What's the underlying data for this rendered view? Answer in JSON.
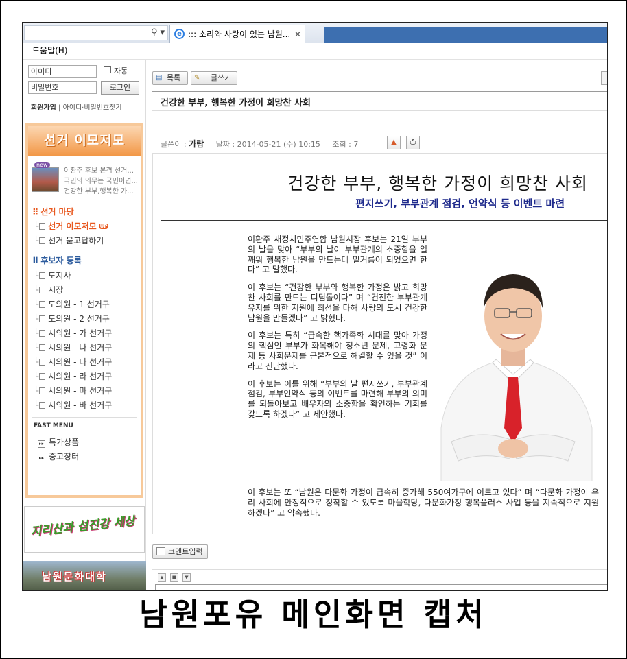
{
  "browser": {
    "tab_title": "::: 소리와 사랑이 있는 남원...",
    "menu": "도움말(H)"
  },
  "login": {
    "id_placeholder": "아이디",
    "pw_placeholder": "비밀번호",
    "auto_label": "자동",
    "login_button": "로그인",
    "join": "회원가입",
    "separator": "|",
    "find": "아이디·비밀번호찾기"
  },
  "sidebar": {
    "banner": "선거 이모저모",
    "new_badge": "new",
    "news": [
      "이환주 후보 본격 선거...",
      "국민의 의무는 국민이면...",
      "건강한 부부,행복한 가..."
    ],
    "section1": "선거 마당",
    "section1_items": [
      "선거 이모저모",
      "선거 묻고답하기"
    ],
    "up_badge": "UP",
    "section2": "후보자 등록",
    "section2_items": [
      "도지사",
      "시장",
      "도의원 - 1 선거구",
      "도의원 - 2 선거구",
      "시의원 - 가 선거구",
      "시의원 - 나 선거구",
      "시의원 - 다 선거구",
      "시의원 - 라 선거구",
      "시의원 - 마 선거구",
      "시의원 - 바 선거구"
    ],
    "fast_menu": "FAST MENU",
    "fast_items": [
      "특가상품",
      "중고장터"
    ],
    "banner1": "지리산과 섬진강 세상",
    "banner2": "남원문화대학"
  },
  "toolbar": {
    "list": "목록",
    "write": "글쓰기"
  },
  "post": {
    "title": "건강한 부부, 행복한 가정이 희망찬 사회",
    "author_label": "글쓴이 :",
    "author": "가람",
    "date_label": "날짜 : 2014-05-21 (수) 10:15",
    "views_label": "조회 : 7",
    "headline": "건강한 부부, 행복한 가정이 희망찬 사회",
    "subhead": "편지쓰기, 부부관계 점검, 언약식 등 이벤트 마련",
    "paragraphs": [
      "이환주 새정치민주연합 남원시장 후보는 21일 부부의 날을 맞아 “부부의 날이 부부관계의 소중함을 일깨워 행복한 남원을 만드는데 밑거름이 되었으면 한다” 고 말했다.",
      "이 후보는 “건강한 부부와 행복한 가정은 밝고 희망찬 사회를 만드는 디딤돌이다” 며 “건전한 부부관계 유지를 위한 지원에 최선을 다해 사랑의 도시 건강한 남원을 만들겠다” 고 밝혔다.",
      "이 후보는 특히 “급속한 핵가족화 시대를 맞아 가정의 핵심인 부부가 화목해야 청소년 문제, 고령화 문제 등 사회문제를 근본적으로 해결할 수 있을 것” 이라고 진단했다.",
      "이 후보는 이를 위해 “부부의 날 편지쓰기, 부부관계 점검, 부부언약식 등의 이벤트를 마련해 부부의 의미를 되돌아보고 배우자의 소중함을 확인하는 기회를 갖도록 하겠다” 고 제안했다."
    ],
    "last_paragraph": "이 후보는 또 “남원은 다문화 가정이 급속히 증가해 550여가구에 이르고 있다” 며 “다문화 가정이 우리 사회에 안정적으로 정착할 수 있도록 마을학당, 다문화가정 행복플러스 사업 등을 지속적으로 지원하겠다” 고 약속했다."
  },
  "comment": {
    "button": "코멘트입력"
  },
  "caption": "남원포유 메인화면 캡처",
  "colors": {
    "accent_orange": "#e8581f",
    "subhead_navy": "#1e2a8c",
    "tab_blue": "#3d6fb0"
  }
}
